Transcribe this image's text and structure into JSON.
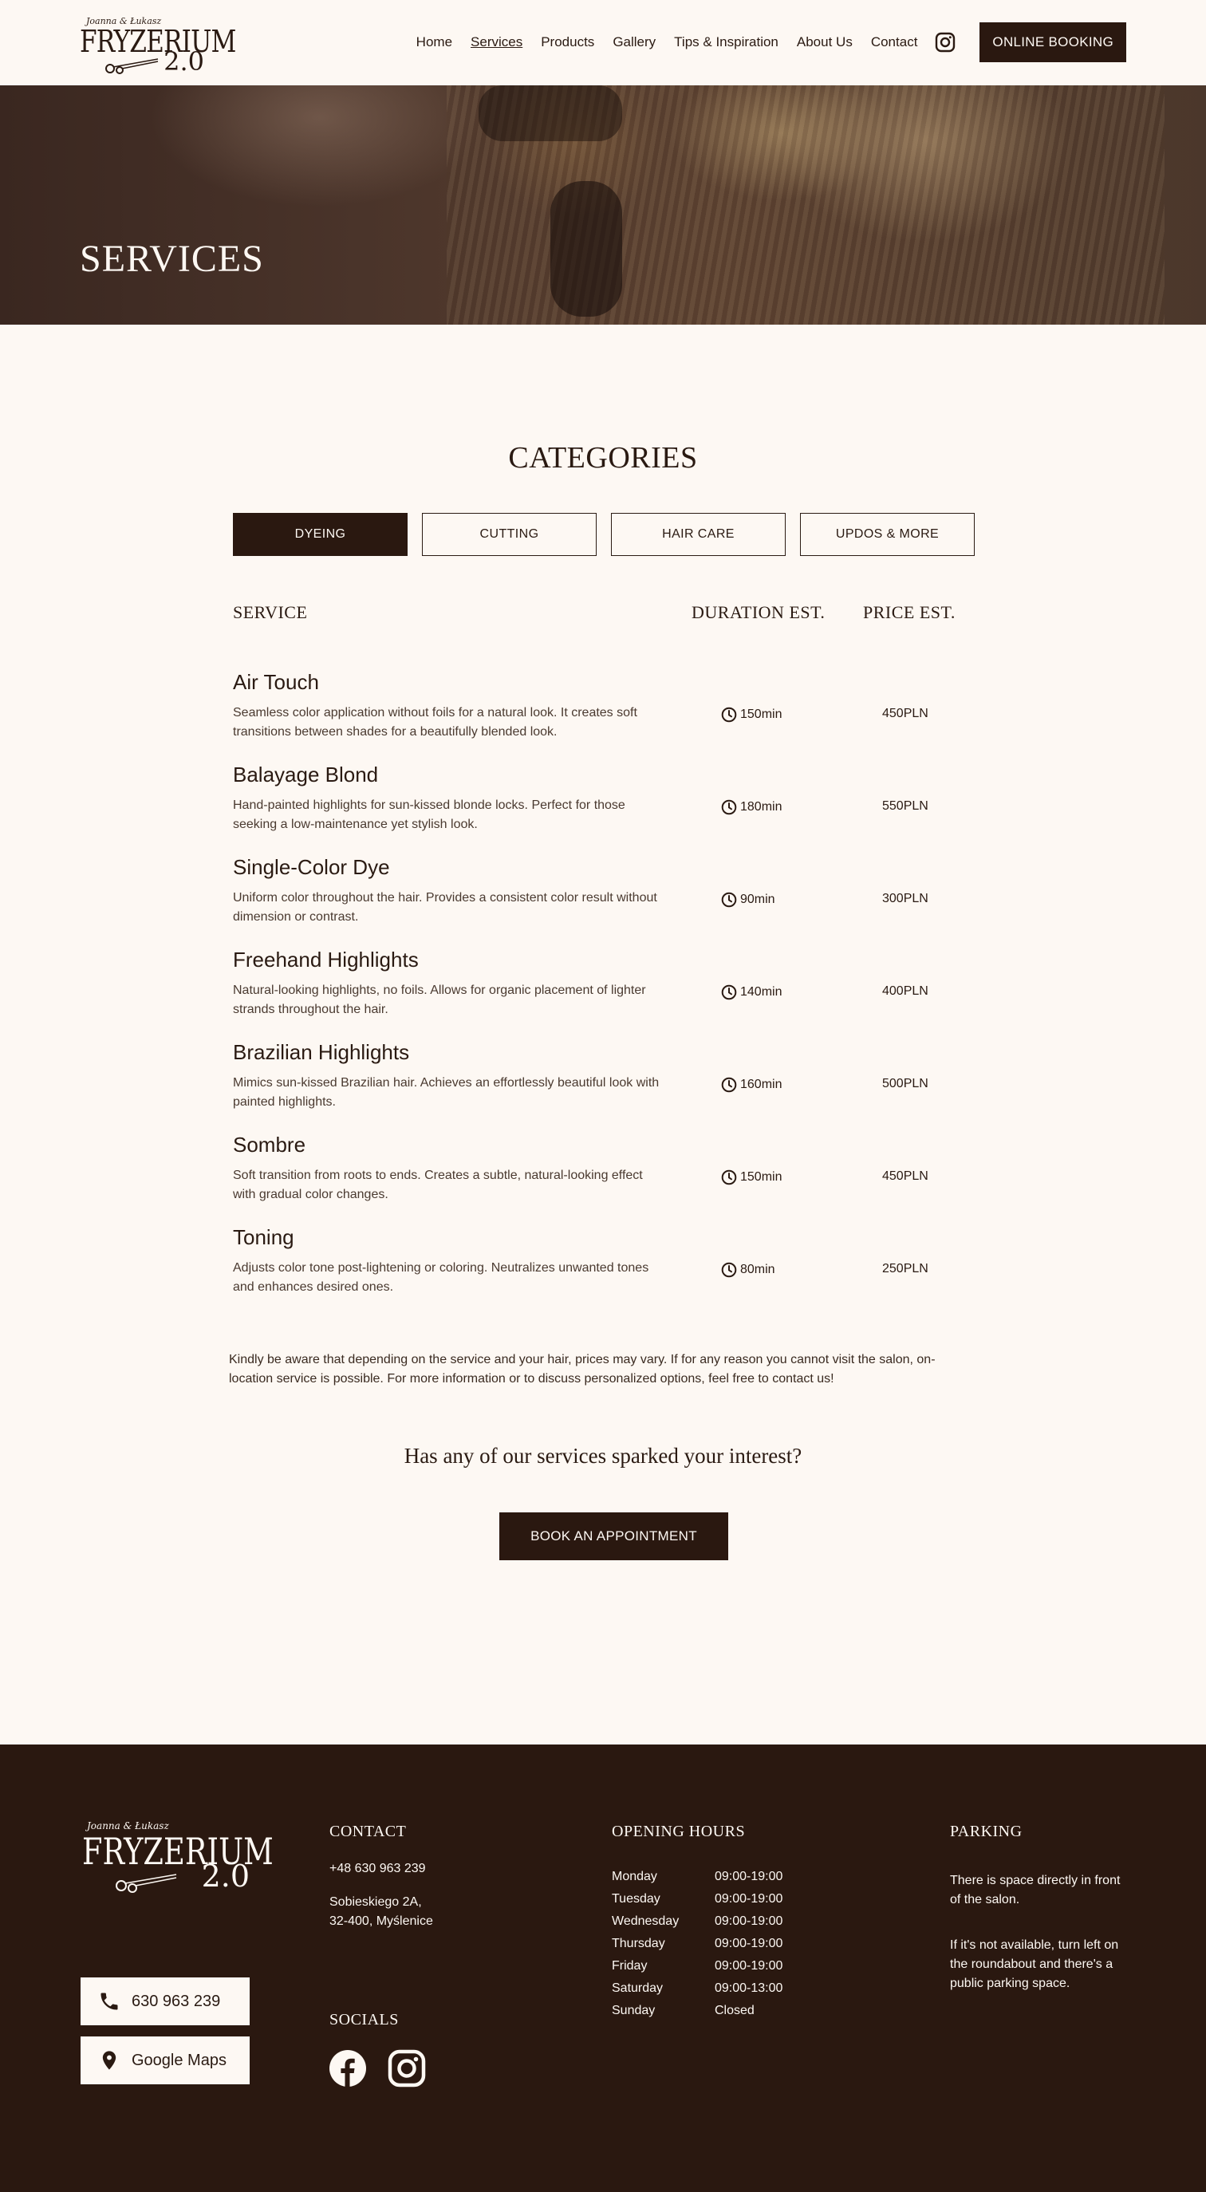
{
  "header": {
    "logo": {
      "top_line": "Joanna & Łukasz",
      "name": "FRYZERIUM",
      "version": "2.0"
    },
    "nav": [
      {
        "label": "Home",
        "active": false
      },
      {
        "label": "Services",
        "active": true
      },
      {
        "label": "Products",
        "active": false
      },
      {
        "label": "Gallery",
        "active": false
      },
      {
        "label": "Tips & Inspiration",
        "active": false
      },
      {
        "label": "About Us",
        "active": false
      },
      {
        "label": "Contact",
        "active": false
      }
    ],
    "instagram_icon": "instagram-icon",
    "booking_label": "ONLINE BOOKING"
  },
  "hero": {
    "title": "SERVICES"
  },
  "categories": {
    "title": "CATEGORIES",
    "tabs": [
      {
        "label": "DYEING",
        "active": true
      },
      {
        "label": "CUTTING",
        "active": false
      },
      {
        "label": "HAIR CARE",
        "active": false
      },
      {
        "label": "UPDOS & MORE",
        "active": false
      }
    ]
  },
  "table": {
    "headers": {
      "service": "SERVICE",
      "duration": "DURATION EST.",
      "price": "PRICE EST."
    },
    "rows": [
      {
        "name": "Air Touch",
        "desc": "Seamless color application without foils for a natural look. It creates soft transitions between shades for a beautifully blended look.",
        "duration": "150min",
        "price": "450PLN"
      },
      {
        "name": "Balayage Blond",
        "desc": "Hand-painted highlights for sun-kissed blonde locks. Perfect for those seeking a low-maintenance yet stylish look.",
        "duration": "180min",
        "price": "550PLN"
      },
      {
        "name": "Single-Color Dye",
        "desc": "Uniform color throughout the hair. Provides a consistent color result without dimension or contrast.",
        "duration": "90min",
        "price": "300PLN"
      },
      {
        "name": "Freehand Highlights",
        "desc": "Natural-looking highlights, no foils. Allows for organic placement of lighter strands throughout the hair.",
        "duration": "140min",
        "price": "400PLN"
      },
      {
        "name": "Brazilian Highlights",
        "desc": "Mimics sun-kissed Brazilian hair. Achieves an effortlessly beautiful look with painted highlights.",
        "duration": "160min",
        "price": "500PLN"
      },
      {
        "name": "Sombre",
        "desc": "Soft transition from roots to ends. Creates a subtle, natural-looking effect with gradual color changes.",
        "duration": "150min",
        "price": "450PLN"
      },
      {
        "name": "Toning",
        "desc": "Adjusts color tone post-lightening or coloring. Neutralizes unwanted tones and enhances desired ones.",
        "duration": "80min",
        "price": "250PLN"
      }
    ]
  },
  "note": "Kindly be aware that depending on the service and your hair, prices may vary. If for any reason you cannot visit the salon, on-location service is possible.  For more information or to discuss personalized options, feel free to contact us!",
  "cta": {
    "question": "Has any of our services sparked your interest?",
    "button": "BOOK AN APPOINTMENT"
  },
  "footer": {
    "logo": {
      "top_line": "Joanna & Łukasz",
      "name": "FRYZERIUM",
      "version": "2.0"
    },
    "phone_button": "630 963 239",
    "maps_button": "Google Maps",
    "contact": {
      "title": "CONTACT",
      "phone": "+48 630 963 239",
      "address_line1": "Sobieskiego 2A,",
      "address_line2": "32-400, Myślenice"
    },
    "socials": {
      "title": "SOCIALS",
      "icons": [
        "facebook-icon",
        "instagram-icon"
      ]
    },
    "hours": {
      "title": "OPENING HOURS",
      "days": [
        {
          "day": "Monday",
          "time": "09:00-19:00"
        },
        {
          "day": "Tuesday",
          "time": "09:00-19:00"
        },
        {
          "day": "Wednesday",
          "time": "09:00-19:00"
        },
        {
          "day": "Thursday",
          "time": "09:00-19:00"
        },
        {
          "day": "Friday",
          "time": "09:00-19:00"
        },
        {
          "day": "Saturday",
          "time": "09:00-13:00"
        },
        {
          "day": "Sunday",
          "time": "Closed"
        }
      ]
    },
    "parking": {
      "title": "PARKING",
      "p1": "There is space directly in front of the salon.",
      "p2": "If it's not available, turn left on the roundabout and there's a public parking space."
    }
  },
  "colors": {
    "background": "#fdf8f3",
    "dark_brown": "#2a1810",
    "text": "#2a1a12"
  }
}
